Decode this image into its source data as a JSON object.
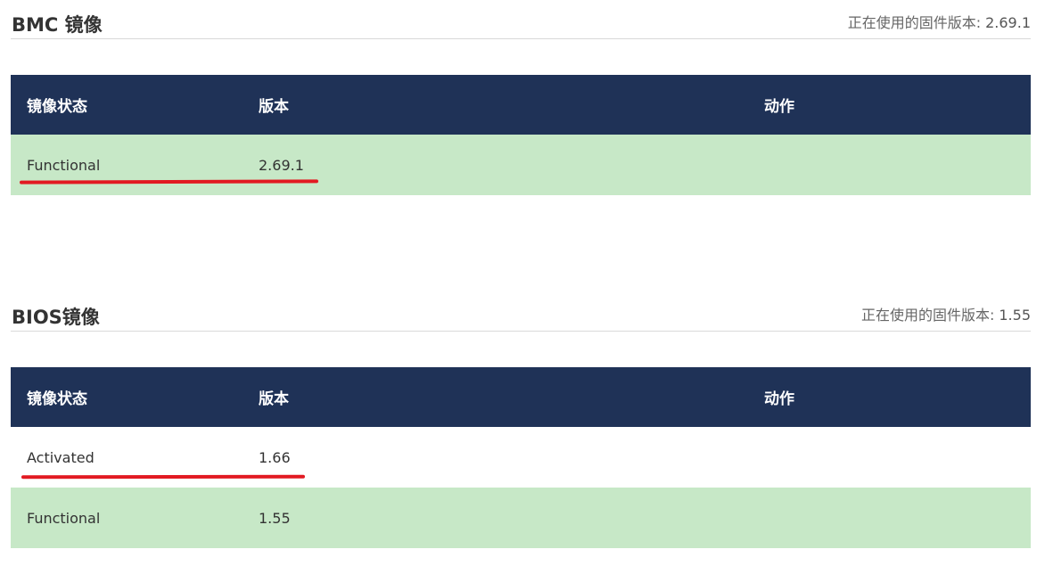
{
  "bmc": {
    "title": "BMC 镜像",
    "fw_label": "正在使用的固件版本:",
    "fw_value": "2.69.1",
    "columns": [
      "镜像状态",
      "版本",
      "动作"
    ],
    "rows": [
      {
        "status": "Functional",
        "version": "2.69.1",
        "action": "",
        "highlight": "#c7e8c7"
      }
    ]
  },
  "bios": {
    "title": "BIOS镜像",
    "fw_label": "正在使用的固件版本:",
    "fw_value": "1.55",
    "columns": [
      "镜像状态",
      "版本",
      "动作"
    ],
    "rows": [
      {
        "status": "Activated",
        "version": "1.66",
        "action": "",
        "highlight": "#ffffff"
      },
      {
        "status": "Functional",
        "version": "1.55",
        "action": "",
        "highlight": "#c7e8c7"
      }
    ]
  },
  "colors": {
    "header_bg": "#1f3257",
    "functional_row_bg": "#c7e8c7",
    "annotation_underline": "#e21a22"
  }
}
